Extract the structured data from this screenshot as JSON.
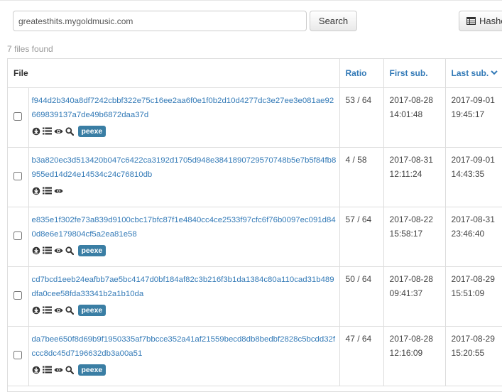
{
  "toolbar": {
    "search_value": "greatesthits.mygoldmusic.com",
    "search_button": "Search",
    "hashes_button": "Hashes"
  },
  "results": {
    "count_text": "7 files found",
    "columns": {
      "file": "File",
      "ratio": "Ratio",
      "first_sub": "First sub.",
      "last_sub": "Last sub."
    },
    "rows": [
      {
        "hash": "f944d2b340a8df7242cbbf322e75c16ee2aa6f0e1f0b2d10d4277dc3e27ee3e081ae92669839137a7de49b6872daa37d",
        "ratio": "53 / 64",
        "first_date": "2017-08-28",
        "first_time": "14:01:48",
        "last_date": "2017-09-01",
        "last_time": "19:45:17",
        "tag": "peexe",
        "has_search": true
      },
      {
        "hash": "b3a820ec3d513420b047c6422ca3192d1705d948e3841890729570748b5e7b5f84fb8955ed14d24e14534c24c76810db",
        "ratio": "4 / 58",
        "first_date": "2017-08-31",
        "first_time": "12:11:24",
        "last_date": "2017-09-01",
        "last_time": "14:43:35",
        "tag": "",
        "has_search": false
      },
      {
        "hash": "e835e1f302fe73a839d9100cbc17bfc87f1e4840cc4ce2533f97cfc6f76b0097ec091d840d8e6e179804cf5a2ea81e58",
        "ratio": "57 / 64",
        "first_date": "2017-08-22",
        "first_time": "15:58:17",
        "last_date": "2017-08-31",
        "last_time": "23:46:40",
        "tag": "peexe",
        "has_search": true
      },
      {
        "hash": "cd7bcd1eeb24eafbb7ae5bc4147d0bf184af82c3b216f3b1da1384c80a110cad31b489dfa0cee58fda33341b2a1b10da",
        "ratio": "50 / 64",
        "first_date": "2017-08-28",
        "first_time": "09:41:37",
        "last_date": "2017-08-29",
        "last_time": "15:51:09",
        "tag": "peexe",
        "has_search": true
      },
      {
        "hash": "da7bee650f8d69b9f1950335af7bbcce352a41af21559becd8db8bedbf2828c5bcdd32fccc8dc45d7196632db3a00a51",
        "ratio": "47 / 64",
        "first_date": "2017-08-28",
        "first_time": "12:16:09",
        "last_date": "2017-08-29",
        "last_time": "15:20:55",
        "tag": "peexe",
        "has_search": true
      }
    ]
  },
  "colors": {
    "link": "#337ab7",
    "tag_bg": "#3a7ea4",
    "border": "#dddddd",
    "muted": "#999999"
  },
  "icons": [
    "download-icon",
    "list-icon",
    "eye-icon",
    "search-icon",
    "chevron-down-icon",
    "table-icon"
  ]
}
